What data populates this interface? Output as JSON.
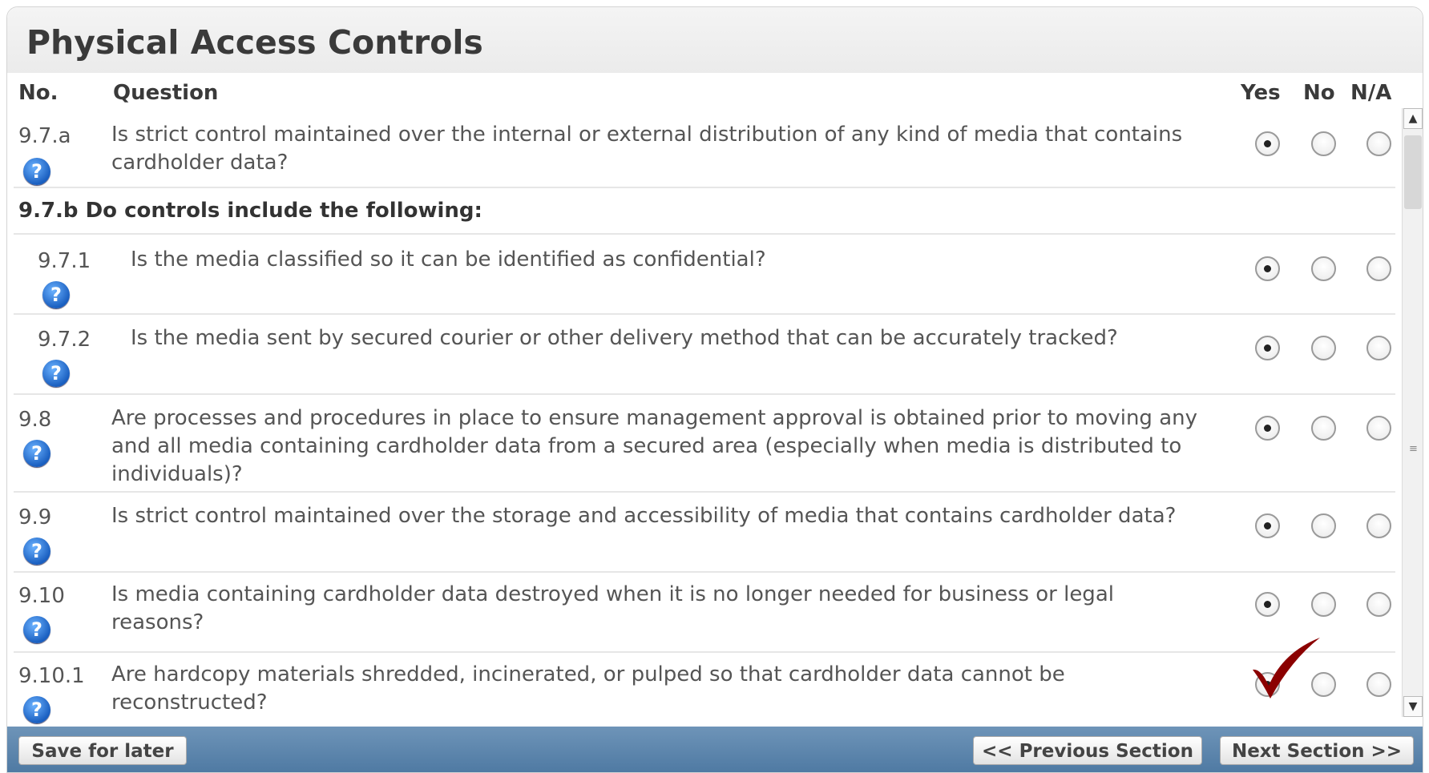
{
  "title": "Physical Access Controls",
  "headers": {
    "no": "No.",
    "question": "Question",
    "yes": "Yes",
    "no_opt": "No",
    "na": "N/A"
  },
  "help_icon_glyph": "?",
  "group_label": "9.7.b Do controls include the following:",
  "rows": [
    {
      "no": "9.7.a",
      "question": "Is strict control maintained over the internal or external distribution of any kind of media that contains",
      "question2": "cardholder data?",
      "answer": "Yes"
    },
    {
      "no": "9.7.1",
      "question": "Is the media classified so it can be identified as confidential?",
      "answer": "Yes"
    },
    {
      "no": "9.7.2",
      "question": "Is the media sent by secured courier or other delivery method that can be accurately tracked?",
      "answer": "Yes"
    },
    {
      "no": "9.8",
      "question": "Are processes and procedures in place to ensure management approval is obtained prior to moving any",
      "question2": "and all media containing cardholder data from a secured area (especially when media is distributed to",
      "question3": "individuals)?",
      "answer": "Yes"
    },
    {
      "no": "9.9",
      "question": "Is strict control maintained over the storage and accessibility of media that contains cardholder data?",
      "answer": "Yes"
    },
    {
      "no": "9.10",
      "question": "Is media containing cardholder data destroyed when it is no longer needed for business or legal",
      "question2": "reasons?",
      "answer": "Yes"
    },
    {
      "no": "9.10.1",
      "question": "Are hardcopy materials shredded, incinerated, or pulped so that cardholder data cannot be",
      "question2": "reconstructed?",
      "answer": "Yes"
    }
  ],
  "scrollbar": {
    "up": "▲",
    "down": "▼",
    "grip": "≡"
  },
  "footer": {
    "save": "Save for later",
    "prev": "<< Previous Section",
    "next": "Next Section >>"
  },
  "colors": {
    "footer": "#5a84ad",
    "check": "#8b0000",
    "help": "#1a5fc0"
  },
  "icons": {
    "help": "help-icon",
    "check": "checkmark-icon"
  }
}
